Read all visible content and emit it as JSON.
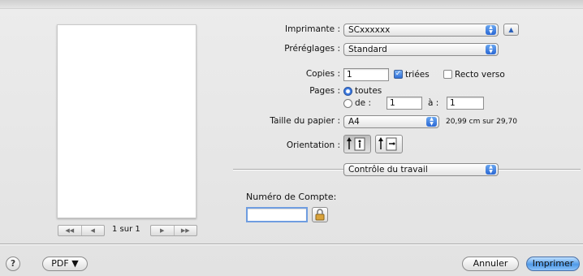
{
  "preview": {
    "page_indicator": "1 sur 1",
    "first_icon": "◀◀",
    "prev_icon": "◀",
    "next_icon": "▶",
    "last_icon": "▶▶"
  },
  "printer": {
    "label": "Imprimante :",
    "value": "SCxxxxxx",
    "collapse_icon": "▲"
  },
  "presets": {
    "label": "Préréglages :",
    "value": "Standard"
  },
  "copies": {
    "label": "Copies :",
    "value": "1",
    "collated_label": "triées",
    "collated": true,
    "duplex_label": "Recto verso",
    "duplex": false
  },
  "pages": {
    "label": "Pages :",
    "all_label": "toutes",
    "range_label": "de :",
    "from": "1",
    "to_label": "à :",
    "to": "1"
  },
  "paper": {
    "label": "Taille du papier :",
    "value": "A4",
    "dimensions": "20,99 cm sur 29,70"
  },
  "orientation": {
    "label": "Orientation :"
  },
  "panel": {
    "value": "Contrôle du travail"
  },
  "account": {
    "label": "Numéro de Compte:",
    "value": ""
  },
  "footer": {
    "help": "?",
    "pdf": "PDF ▼",
    "cancel": "Annuler",
    "print": "Imprimer"
  },
  "colors": {
    "accent": "#3a78e0",
    "background": "#e6e6e6"
  }
}
